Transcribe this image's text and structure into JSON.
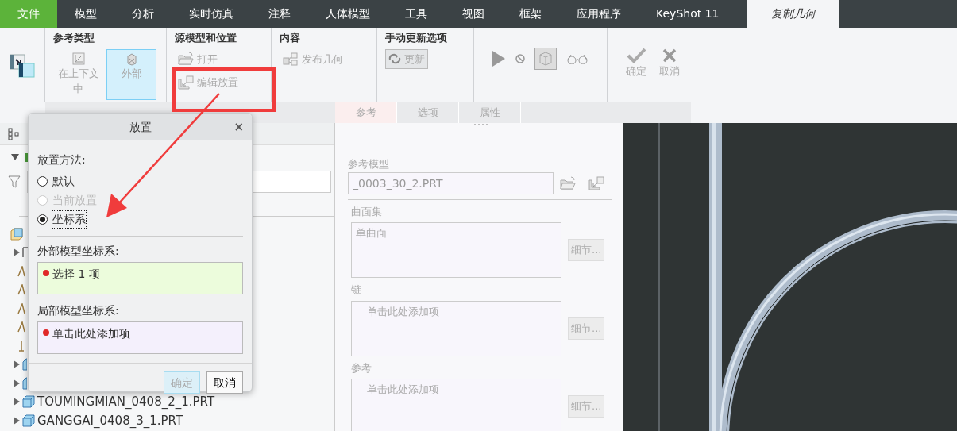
{
  "menu_tabs": [
    {
      "label": "文件",
      "kind": "file",
      "selected": false
    },
    {
      "label": "模型",
      "kind": "tab",
      "selected": false
    },
    {
      "label": "分析",
      "kind": "tab",
      "selected": false
    },
    {
      "label": "实时仿真",
      "kind": "tab",
      "selected": false
    },
    {
      "label": "注释",
      "kind": "tab",
      "selected": false
    },
    {
      "label": "人体模型",
      "kind": "tab",
      "selected": false
    },
    {
      "label": "工具",
      "kind": "tab",
      "selected": false
    },
    {
      "label": "视图",
      "kind": "tab",
      "selected": false
    },
    {
      "label": "框架",
      "kind": "tab",
      "selected": false
    },
    {
      "label": "应用程序",
      "kind": "tab",
      "selected": false
    },
    {
      "label": "KeyShot 11",
      "kind": "tab",
      "selected": false
    },
    {
      "label": "复制几何",
      "kind": "tab",
      "selected": true
    }
  ],
  "reference_type": {
    "title": "参考类型",
    "options": [
      {
        "label": "在上下文中",
        "selected": false
      },
      {
        "label": "外部",
        "selected": true
      }
    ]
  },
  "source_model": {
    "title": "源模型和位置",
    "actions": [
      {
        "label": "打开",
        "kind": "open",
        "disabled": true
      },
      {
        "label": "编辑放置",
        "kind": "placement",
        "disabled": true
      }
    ]
  },
  "content": {
    "title": "内容",
    "actions": [
      {
        "label": "发布几何",
        "kind": "publish",
        "disabled": true
      }
    ]
  },
  "manual_update": {
    "title": "手动更新选项",
    "actions": [
      {
        "label": "更新",
        "kind": "refresh",
        "disabled": true
      }
    ]
  },
  "confirm_actions": [
    {
      "label": "确定",
      "kind": "ok"
    },
    {
      "label": "取消",
      "kind": "cancel"
    }
  ],
  "panel_tabs": [
    {
      "label": "参考",
      "selected": true
    },
    {
      "label": "选项",
      "selected": false
    },
    {
      "label": "属性",
      "selected": false
    }
  ],
  "model_tree": {
    "root": {
      "expanded": true
    },
    "rows": [
      {
        "kind": "assembly"
      },
      {
        "kind": "group",
        "expanded": false
      },
      {
        "kind": "feature"
      },
      {
        "kind": "feature"
      },
      {
        "kind": "feature"
      },
      {
        "kind": "feature"
      },
      {
        "kind": "datum"
      },
      {
        "kind": "part",
        "expanded": false
      },
      {
        "kind": "part",
        "expanded": false
      },
      {
        "kind": "part",
        "expanded": false,
        "label": "TOUMINGMIAN_0408_2_1.PRT"
      },
      {
        "kind": "part",
        "expanded": false,
        "label": "GANGGAI_0408_3_1.PRT"
      }
    ]
  },
  "references_panel": {
    "reference_model": {
      "label": "参考模型",
      "value": "_0003_30_2.PRT"
    },
    "collectors": [
      {
        "label": "曲面集",
        "value": "单曲面",
        "button": "细节..."
      },
      {
        "label": "链",
        "placeholder": "单击此处添加项",
        "button": "细节..."
      },
      {
        "label": "参考",
        "placeholder": "单击此处添加项",
        "button": "细节..."
      }
    ]
  },
  "placement_dialog": {
    "title": "放置",
    "close": "×",
    "method_label": "放置方法:",
    "methods": [
      {
        "label": "默认",
        "selected": false,
        "disabled": false
      },
      {
        "label": "当前放置",
        "selected": false,
        "disabled": true
      },
      {
        "label": "坐标系",
        "selected": true,
        "disabled": false
      }
    ],
    "collectors": [
      {
        "label": "外部模型坐标系:",
        "value": "选择 1 项",
        "color": "#ecfcdc"
      },
      {
        "label": "局部模型坐标系:",
        "value": "单击此处添加项",
        "color": "#f4f0fc"
      }
    ],
    "buttons": [
      {
        "label": "确定",
        "disabled": true
      },
      {
        "label": "取消",
        "disabled": false
      }
    ]
  }
}
